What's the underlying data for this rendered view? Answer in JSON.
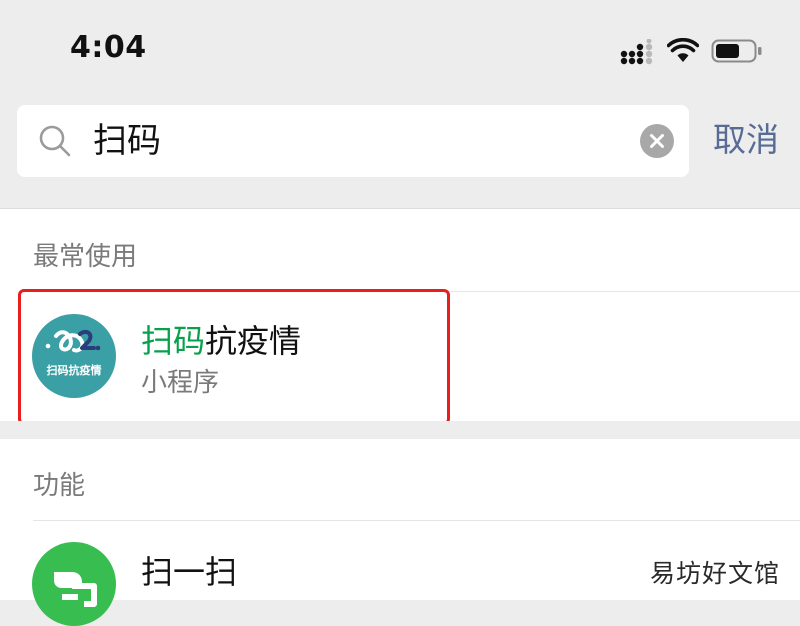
{
  "status_bar": {
    "time": "4:04",
    "icons": [
      "cellular-signal-icon",
      "wifi-icon",
      "battery-icon"
    ],
    "battery_level": 0.65
  },
  "search": {
    "query": "扫码",
    "icon": "search-icon",
    "clear_icon": "clear-icon",
    "cancel_label": "取消"
  },
  "sections": {
    "frequent": {
      "label": "最常使用",
      "items": [
        {
          "title_highlight": "扫码",
          "title_rest": "抗疫情",
          "subtitle": "小程序",
          "icon": "mini-program-logo-icon",
          "logo_text": "扫码抗疫情"
        }
      ]
    },
    "features": {
      "label": "功能",
      "items": [
        {
          "label": "扫一扫",
          "icon": "scan-icon"
        }
      ]
    }
  },
  "watermark": "易坊好文馆",
  "colors": {
    "accent_link": "#576b95",
    "highlight_text": "#07a04b",
    "annotation_box": "#e8201d",
    "app_icon_bg": "#3b9fa6",
    "scan_icon_bg": "#38bd51",
    "page_bg": "#ededed"
  }
}
